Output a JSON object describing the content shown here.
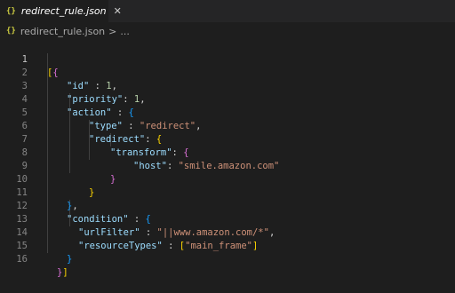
{
  "tab": {
    "icon": "{}",
    "title": "redirect_rule.json",
    "close": "✕"
  },
  "breadcrumb": {
    "icon": "{}",
    "file": "redirect_rule.json",
    "separator": ">",
    "more": "..."
  },
  "editor": {
    "line_numbers": [
      "1",
      "2",
      "3",
      "4",
      "5",
      "6",
      "7",
      "8",
      "9",
      "10",
      "11",
      "12",
      "13",
      "14",
      "15",
      "16"
    ],
    "tokens": {
      "l1_b1": "[",
      "l1_b2": "{",
      "l2_key": "\"id\"",
      "l2_colon": " : ",
      "l2_val": "1",
      "l2_comma": ",",
      "l3_key": "\"priority\"",
      "l3_colon": ": ",
      "l3_val": "1",
      "l3_comma": ",",
      "l4_key": "\"action\"",
      "l4_colon": " : ",
      "l4_brace": "{",
      "l5_key": "\"type\"",
      "l5_colon": " : ",
      "l5_val": "\"redirect\"",
      "l5_comma": ",",
      "l6_key": "\"redirect\"",
      "l6_colon": ": ",
      "l6_brace": "{",
      "l7_key": "\"transform\"",
      "l7_colon": ": ",
      "l7_brace": "{",
      "l8_key": "\"host\"",
      "l8_colon": ": ",
      "l8_val": "\"smile.amazon.com\"",
      "l9_brace": "}",
      "l10_brace": "}",
      "l11_brace": "}",
      "l11_comma": ",",
      "l12_key": "\"condition\"",
      "l12_colon": " : ",
      "l12_brace": "{",
      "l13_key": "\"urlFilter\"",
      "l13_colon": " : ",
      "l13_val": "\"||www.amazon.com/*\"",
      "l13_comma": ",",
      "l14_key": "\"resourceTypes\"",
      "l14_colon": " : ",
      "l14_b_open": "[",
      "l14_val": "\"main_frame\"",
      "l14_b_close": "]",
      "l15_brace": "}",
      "l16_b2": "}",
      "l16_b1": "]"
    }
  }
}
